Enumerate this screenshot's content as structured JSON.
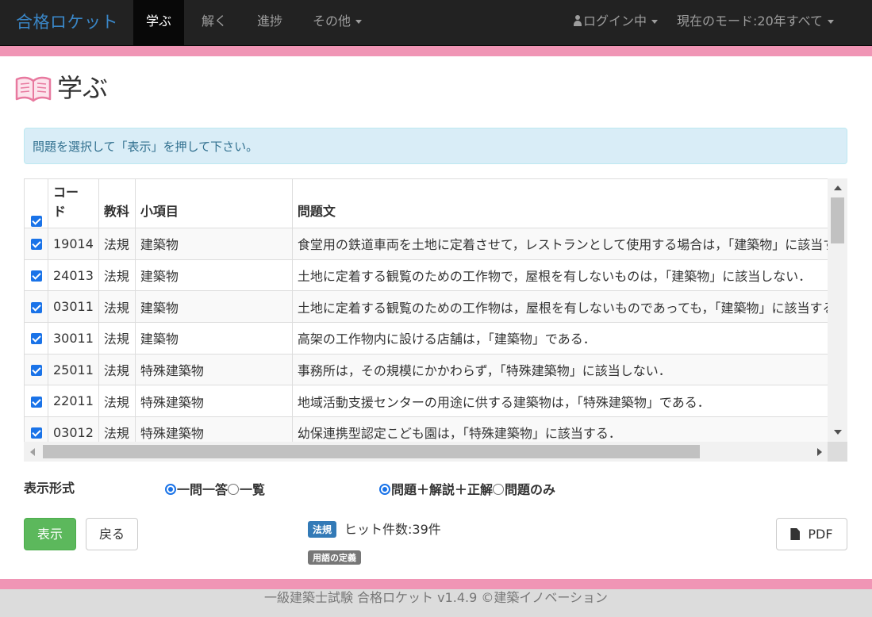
{
  "navbar": {
    "brand": "合格ロケット",
    "items": [
      {
        "label": "学ぶ",
        "active": true
      },
      {
        "label": "解く"
      },
      {
        "label": "進捗"
      },
      {
        "label": "その他"
      }
    ],
    "login": "ログイン中",
    "mode": "現在のモード:20年すべて"
  },
  "page": {
    "title": "学ぶ",
    "icon": "open-book-icon"
  },
  "alert": "問題を選択して「表示」を押して下さい。",
  "table": {
    "headers": {
      "code_line1": "コー",
      "code_line2": "ド",
      "subject": "教科",
      "item": "小項目",
      "question": "問題文"
    },
    "rows": [
      {
        "code": "19014",
        "subject": "法規",
        "item": "建築物",
        "question": "食堂用の鉄道車両を土地に定着させて，レストランとして使用する場合は，「建築物」に該当する．"
      },
      {
        "code": "24013",
        "subject": "法規",
        "item": "建築物",
        "question": "土地に定着する観覧のための工作物で，屋根を有しないものは，「建築物」に該当しない．"
      },
      {
        "code": "03011",
        "subject": "法規",
        "item": "建築物",
        "question": "土地に定着する観覧のための工作物は，屋根を有しないものであっても，「建築物」に該当する．"
      },
      {
        "code": "30011",
        "subject": "法規",
        "item": "建築物",
        "question": "高架の工作物内に設ける店舗は，「建築物」である．"
      },
      {
        "code": "25011",
        "subject": "法規",
        "item": "特殊建築物",
        "question": "事務所は，その規模にかかわらず，「特殊建築物」に該当しない．"
      },
      {
        "code": "22011",
        "subject": "法規",
        "item": "特殊建築物",
        "question": "地域活動支援センターの用途に供する建築物は，「特殊建築物」である．"
      },
      {
        "code": "03012",
        "subject": "法規",
        "item": "特殊建築物",
        "question": "幼保連携型認定こども園は，「特殊建築物」に該当する．"
      }
    ]
  },
  "format": {
    "label": "表示形式",
    "option_one": "一問一答",
    "option_list": "一覧",
    "option_full": "問題＋解説＋正解",
    "option_question_only": "問題のみ"
  },
  "buttons": {
    "show": "表示",
    "back": "戻る",
    "pdf": "PDF"
  },
  "summary": {
    "subject_badge": "法規",
    "hits": "ヒット件数:39件",
    "category_badge": "用語の定義"
  },
  "footer": "一級建築士試験 合格ロケット v1.4.9 ©建築イノベーション",
  "colors": {
    "accent_pink": "#f095b5",
    "navbar": "#222222",
    "brand": "#3a87c8",
    "success": "#5cb85c",
    "primary_label": "#337ab7"
  }
}
